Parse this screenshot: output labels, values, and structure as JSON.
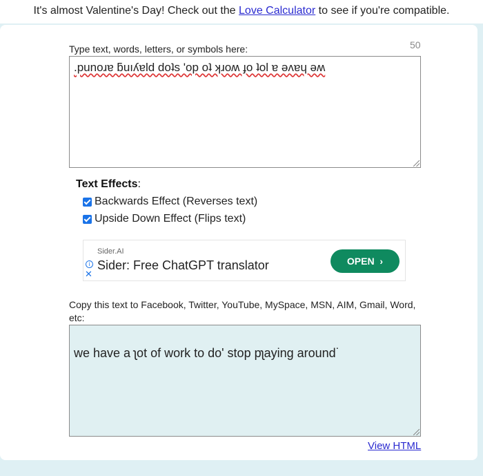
{
  "banner": {
    "before": "It's almost Valentine's Day! Check out the ",
    "link": "Love Calculator",
    "after": " to see if you're compatible."
  },
  "input": {
    "label": "Type text, words, letters, or symbols here:",
    "char_count": "50",
    "value": ".punoɹɐ ƃuıʎɐld doʇs 'op oʇ ʞɹoʍ ɟo ʇol ɐ ǝʌɐɥ ǝʍ"
  },
  "effects": {
    "title": "Text Effects",
    "title_suffix": ":",
    "options": [
      {
        "label": "Backwards Effect (Reverses text)",
        "checked": true
      },
      {
        "label": "Upside Down Effect (Flips text)",
        "checked": true
      }
    ]
  },
  "ad": {
    "brand": "Sider.AI",
    "title": "Sider: Free ChatGPT translator",
    "button": "OPEN",
    "button_icon": "chevron-right-icon",
    "info_icon": "info-icon",
    "close_icon": "close-icon"
  },
  "output": {
    "label": "Copy this text to Facebook, Twitter, YouTube, MySpace, MSN, AIM, Gmail, Word, etc:",
    "value": "we have a ʅot of work to do' stop pʅaying around˙"
  },
  "links": {
    "view_html": "View HTML"
  },
  "colors": {
    "page_bg": "#dff0f4",
    "link": "#2a2ad0",
    "output_bg": "#e0f0f2",
    "ad_button": "#0f8a5f",
    "checkbox": "#1a73e8"
  }
}
